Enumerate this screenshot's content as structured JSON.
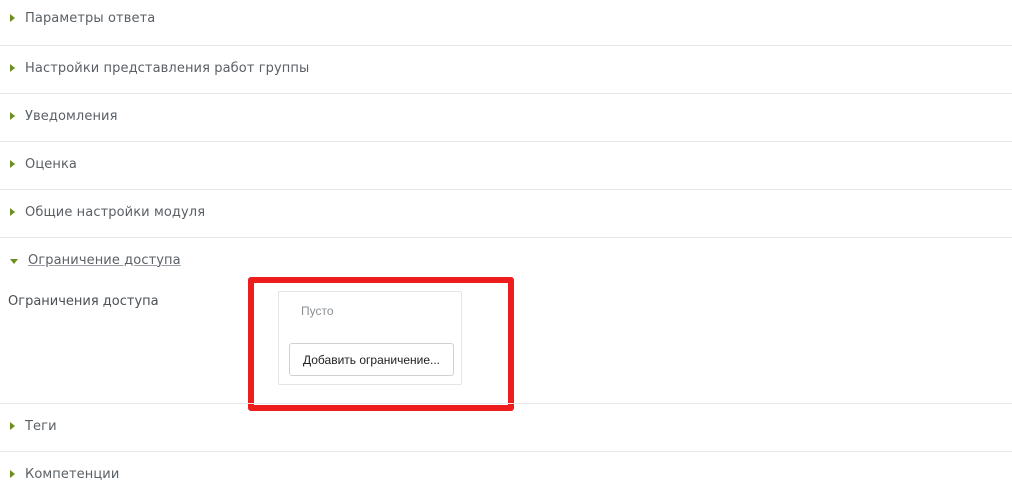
{
  "sections": [
    {
      "label": "Параметры ответа",
      "expanded": false
    },
    {
      "label": "Настройки представления работ группы",
      "expanded": false
    },
    {
      "label": "Уведомления",
      "expanded": false
    },
    {
      "label": "Оценка",
      "expanded": false
    },
    {
      "label": "Общие настройки модуля",
      "expanded": false
    },
    {
      "label": "Ограничение доступа",
      "expanded": true
    },
    {
      "label": "Теги",
      "expanded": false
    },
    {
      "label": "Компетенции",
      "expanded": false
    }
  ],
  "access_restriction": {
    "field_label": "Ограничения доступа",
    "empty_text": "Пусто",
    "add_button_label": "Добавить ограничение..."
  },
  "colors": {
    "highlight": "#ee1c1c",
    "accent_arrow": "#6b8e23"
  },
  "icons": {
    "collapsed": "triangle-right",
    "expanded": "triangle-down"
  }
}
